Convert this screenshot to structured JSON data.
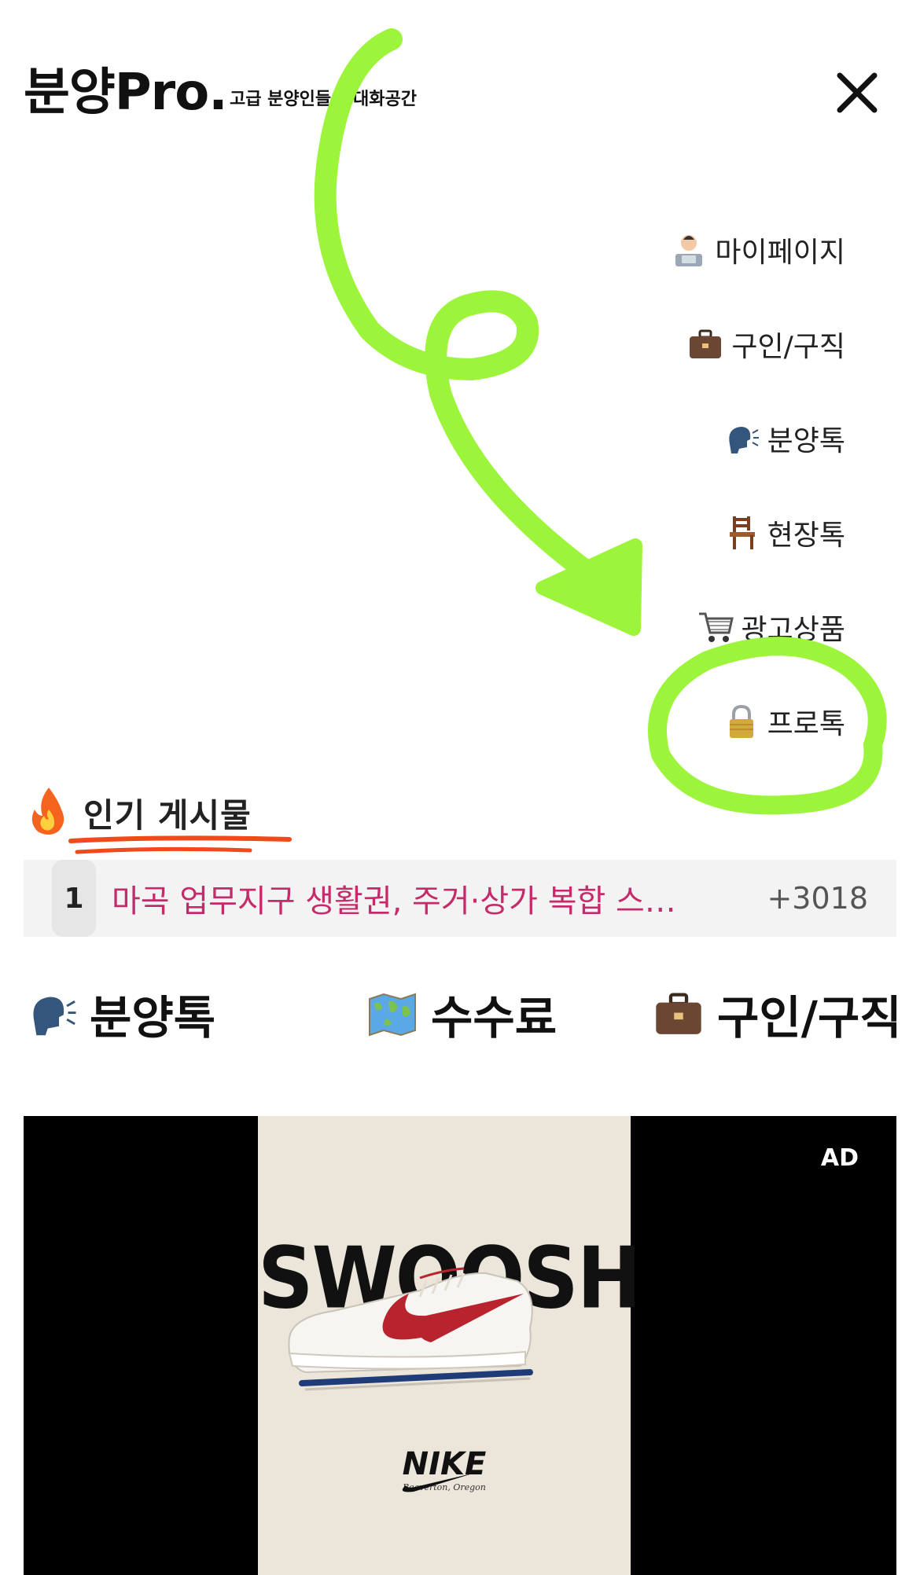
{
  "header": {
    "logo": "분양Pro.",
    "tagline": "고급 분양인들의 대화공간"
  },
  "menu": {
    "items": [
      {
        "label": "마이페이지",
        "icon": "office-worker-icon"
      },
      {
        "label": "구인/구직",
        "icon": "briefcase-icon"
      },
      {
        "label": "분양톡",
        "icon": "speaking-head-icon"
      },
      {
        "label": "현장톡",
        "icon": "chair-icon"
      },
      {
        "label": "광고상품",
        "icon": "shopping-cart-icon"
      },
      {
        "label": "프로톡",
        "icon": "lock-icon"
      }
    ]
  },
  "popular": {
    "title": "인기 게시물",
    "icon": "fire-icon",
    "posts": [
      {
        "rank": "1",
        "title": "마곡 업무지구 생활권, 주거·상가 복합 스…",
        "count": "+3018"
      }
    ]
  },
  "categories": [
    {
      "label": "분양톡",
      "icon": "speaking-head-icon"
    },
    {
      "label": "수수료",
      "icon": "world-map-icon"
    },
    {
      "label": "구인/구직",
      "icon": "briefcase-icon"
    }
  ],
  "ad": {
    "badge": "AD",
    "headline": "SWOOSH",
    "brand": "NIKE",
    "brand_sub": "Beaverton, Oregon"
  },
  "colors": {
    "annotation_green": "#9cf53a",
    "underline_orange": "#f04a1c",
    "post_title": "#c52a6b"
  }
}
